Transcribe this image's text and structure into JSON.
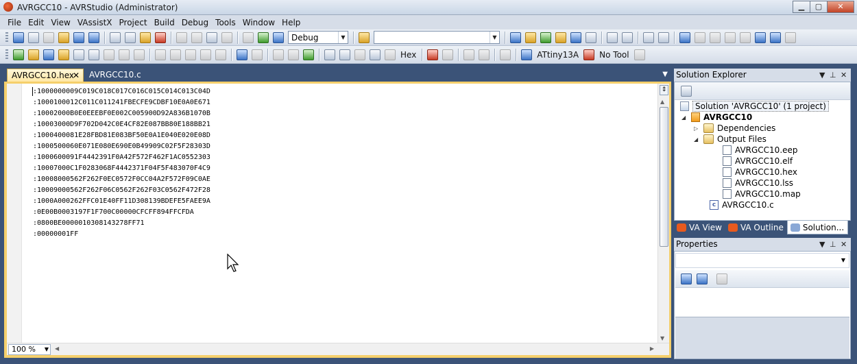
{
  "window": {
    "title": "AVRGCC10 - AVRStudio (Administrator)",
    "controls": [
      "minimize",
      "maximize",
      "close"
    ]
  },
  "menubar": {
    "items": [
      "File",
      "Edit",
      "View",
      "VAssistX",
      "Project",
      "Build",
      "Debug",
      "Tools",
      "Window",
      "Help"
    ]
  },
  "toolbar": {
    "configuration": "Debug",
    "find_value": "",
    "hex_label": "Hex",
    "device": "ATtiny13A",
    "tool": "No Tool"
  },
  "editor": {
    "tabs": [
      {
        "label": "AVRGCC10.hex",
        "active": true
      },
      {
        "label": "AVRGCC10.c",
        "active": false
      }
    ],
    "lines": [
      ":1000000009C019C018C017C016C015C014C013C04D",
      ":1000100012C011C011241FBECFE9CDBF10E0A0E671",
      ":10002000B0E0EEEBF0E002C005900D92A836B1070B",
      ":10003000D9F702D042C0E4CF82E087BB80E188BB21",
      ":1000400081E28FBD81E083BF50E0A1E040E020E08D",
      ":1000500060E071E080E690E0B49909C02F5F28303D",
      ":1000600091F4442391F0A42F572F462F1AC0552303",
      ":10007000C1F0283068F4442371F04F5F483070F4C9",
      ":10008000562F262F0EC0572F0CC04A2F572F09C0AE",
      ":10009000562F262F06C0562F262F03C0562F472F28",
      ":1000A000262FFC01E40FF11D308139BDEFE5FAEE9A",
      ":0E00B0003197F1F700C00000CFCFF894FFCFDA",
      ":0800BE0000010308143278FF71",
      ":00000001FF"
    ],
    "zoom": "100 %"
  },
  "solution_explorer": {
    "title": "Solution Explorer",
    "solution": "Solution 'AVRGCC10' (1 project)",
    "project": "AVRGCC10",
    "dependencies": "Dependencies",
    "output_folder": "Output Files",
    "output_files": [
      "AVRGCC10.eep",
      "AVRGCC10.elf",
      "AVRGCC10.hex",
      "AVRGCC10.lss",
      "AVRGCC10.map"
    ],
    "source_file": "AVRGCC10.c",
    "tabs": [
      "VA View",
      "VA Outline",
      "Solution..."
    ]
  },
  "properties": {
    "title": "Properties"
  }
}
